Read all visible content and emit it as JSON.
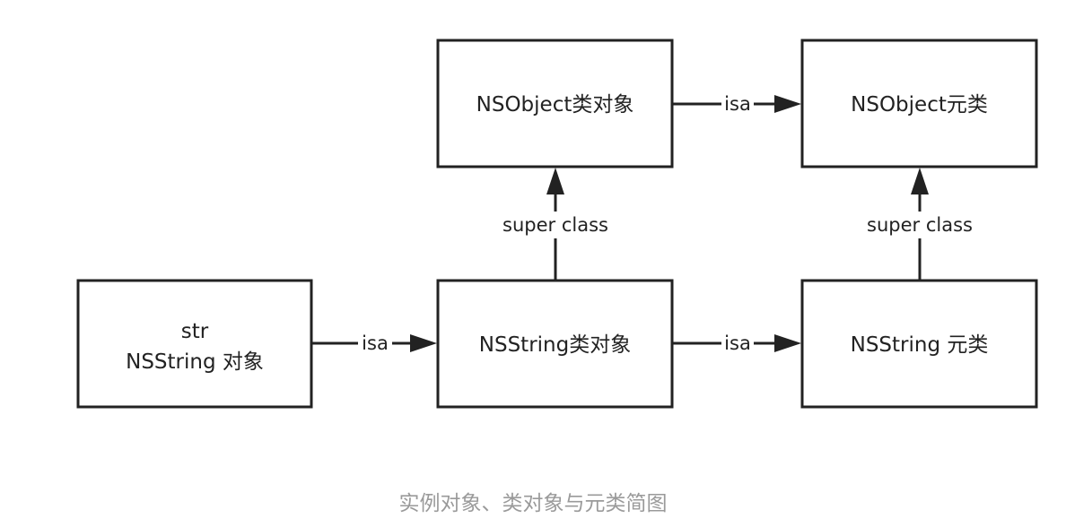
{
  "diagram": {
    "nodes": {
      "nsobject_class": {
        "label": "NSObject类对象"
      },
      "nsobject_meta": {
        "label": "NSObject元类"
      },
      "str_instance": {
        "line1": "str",
        "line2": "NSString 对象"
      },
      "nsstring_class": {
        "label": "NSString类对象"
      },
      "nsstring_meta": {
        "label": "NSString 元类"
      }
    },
    "edges": {
      "isa_1": {
        "label": "isa"
      },
      "isa_2": {
        "label": "isa"
      },
      "isa_3": {
        "label": "isa"
      },
      "super_1": {
        "label": "super class"
      },
      "super_2": {
        "label": "super class"
      }
    }
  },
  "caption": "实例对象、类对象与元类简图"
}
